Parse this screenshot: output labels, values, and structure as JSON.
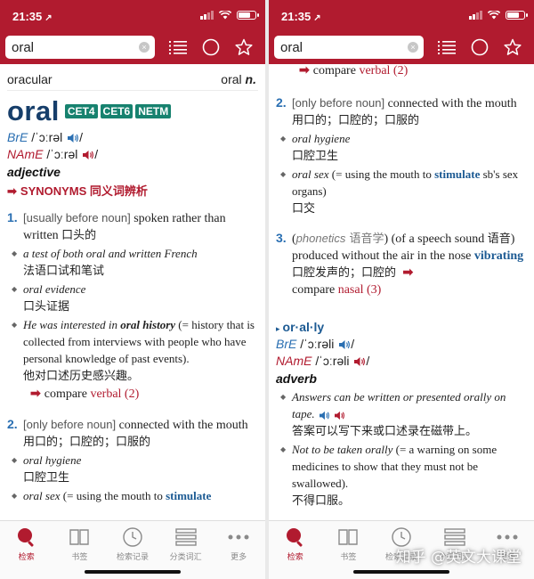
{
  "status": {
    "time": "21:35",
    "location_arrow": "↗"
  },
  "search": {
    "value": "oral",
    "clear": "×"
  },
  "toolbar_icons": [
    "list-icon",
    "circle-icon",
    "star-icon"
  ],
  "left": {
    "nav_prev": "oracular",
    "nav_next_word": "oral",
    "nav_next_pos": "n.",
    "headword": "oral",
    "badges": [
      "CET4",
      "CET6",
      "NETM"
    ],
    "bre_label": "BrE",
    "bre_ipa": "/ˈɔːrəl",
    "name_label": "NAmE",
    "name_ipa": "/ˈɔːrəl",
    "slash": "/",
    "pos": "adjective",
    "synonyms": "SYNONYMS 同义词辨析",
    "sense1": {
      "num": "1.",
      "gram": "[usually before noun]",
      "def": " spoken rather than written ",
      "def_zh": "口头的",
      "ex1_en": "a test of both oral and written French",
      "ex1_zh": "法语口试和笔试",
      "ex2_en": "oral evidence",
      "ex2_zh": "口头证据",
      "ex3_pre": "He was interested in ",
      "ex3_bold": "oral history",
      "ex3_post": " (= history that is collected from interviews with people who have personal knowledge of past events).",
      "ex3_zh": "他对口述历史感兴趣。",
      "compare": "compare",
      "compare_word": "verbal",
      "compare_num": "(2)"
    },
    "sense2": {
      "num": "2.",
      "gram": "[only before noun]",
      "def": " connected with the mouth ",
      "def_zh": "用口的；口腔的；口服的",
      "ex1_en": "oral hygiene",
      "ex1_zh": "口腔卫生",
      "ex2_en": "oral sex",
      "ex2_post": " (= using the mouth to ",
      "ex2_kw": "stimulate"
    }
  },
  "right": {
    "top_compare": "compare",
    "top_compare_word": "verbal",
    "top_compare_num": "(2)",
    "sense2": {
      "num": "2.",
      "gram": "[only before noun]",
      "def": " connected with the mouth ",
      "def_zh": "用口的；口腔的；口服的",
      "ex1_en": "oral hygiene",
      "ex1_zh": "口腔卫生",
      "ex2_en": "oral sex",
      "ex2_post": " (= using the mouth to ",
      "ex2_kw": "stimulate",
      "ex2_tail": " sb's sex organs)",
      "ex2_zh": "口交"
    },
    "sense3": {
      "num": "3.",
      "reg_open": "(",
      "reg": "phonetics",
      "reg_zh": " 语音学",
      "reg_close": ") ",
      "def": "(of a speech sound ",
      "def_zh1": "语音",
      "def2": ") produced without the air in the nose ",
      "kw": "vibrating",
      "def_zh2": " 口腔发声的；口腔的",
      "compare": "compare",
      "compare_word": "nasal",
      "compare_num": "(3)"
    },
    "deriv": {
      "marker": "▸",
      "word": "or·al·ly",
      "bre_label": "BrE",
      "bre_ipa": "/ˈɔːrəli",
      "name_label": "NAmE",
      "name_ipa": "/ˈɔːrəli",
      "slash": "/",
      "pos": "adverb",
      "ex1_en": "Answers can be written or presented orally on tape.",
      "ex1_zh": "答案可以写下来或口述录在磁带上。",
      "ex2_en": "Not to be taken orally",
      "ex2_post": " (= a warning on some medicines to show that they must not be swallowed).",
      "ex2_zh": "不得口服。"
    }
  },
  "tabs": [
    {
      "label": "检索",
      "icon": "search-tab-icon",
      "active": true
    },
    {
      "label": "书签",
      "icon": "book-icon",
      "active": false
    },
    {
      "label": "检索记录",
      "icon": "clock-icon",
      "active": false
    },
    {
      "label": "分类词汇",
      "icon": "list-icon",
      "active": false
    },
    {
      "label": "更多",
      "icon": "more-icon",
      "active": false
    }
  ],
  "watermark": "知乎 @英文大课堂",
  "colors": {
    "brand": "#b11b2f",
    "headword": "#163e6a",
    "badge": "#17826f",
    "link_blue": "#2a6fb2"
  }
}
